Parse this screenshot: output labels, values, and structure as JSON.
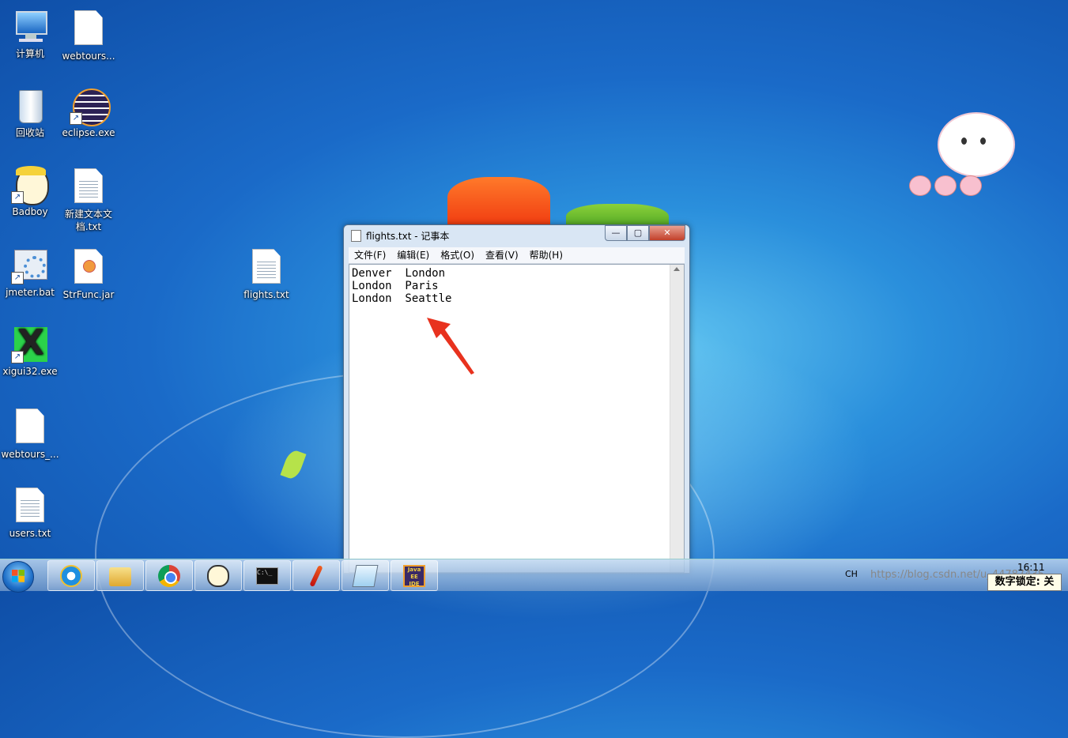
{
  "desktop": {
    "icons": [
      {
        "label": "计算机",
        "icon": "computer-icon"
      },
      {
        "label": "webtours...",
        "icon": "file-icon"
      },
      {
        "label": "回收站",
        "icon": "recycle-bin-icon"
      },
      {
        "label": "eclipse.exe",
        "icon": "eclipse-icon"
      },
      {
        "label": "Badboy",
        "icon": "badboy-icon"
      },
      {
        "label": "新建文本文档.txt",
        "icon": "text-file-icon"
      },
      {
        "label": "jmeter.bat",
        "icon": "batch-file-icon"
      },
      {
        "label": "StrFunc.jar",
        "icon": "jar-file-icon"
      },
      {
        "label": "flights.txt",
        "icon": "text-file-icon"
      },
      {
        "label": "xigui32.exe",
        "icon": "xigui-icon"
      },
      {
        "label": "webtours_...",
        "icon": "file-icon"
      },
      {
        "label": "users.txt",
        "icon": "text-file-icon"
      }
    ]
  },
  "notepad": {
    "title": "flights.txt - 记事本",
    "menu": [
      "文件(F)",
      "编辑(E)",
      "格式(O)",
      "查看(V)",
      "帮助(H)"
    ],
    "content": "Denver  London\nLondon  Paris\nLondon  Seattle",
    "buttons": {
      "minimize": "—",
      "maximize": "▢",
      "close": "✕"
    }
  },
  "taskbar": {
    "apps": [
      "internet-explorer-icon",
      "file-explorer-icon",
      "chrome-icon",
      "badboy-icon",
      "cmd-icon",
      "feather-icon",
      "notepad-icon",
      "java-ee-ide-icon"
    ],
    "java_ide_label": "Java EE IDE",
    "cmd_label": "C:\\_",
    "tray_lang": "CH",
    "watermark": "https://blog.csdn.net/u_44787435",
    "time": "16:11",
    "numlock": "数字锁定: 关"
  },
  "colors": {
    "accent": "#1a6ac8",
    "arrow": "#e8321e"
  }
}
